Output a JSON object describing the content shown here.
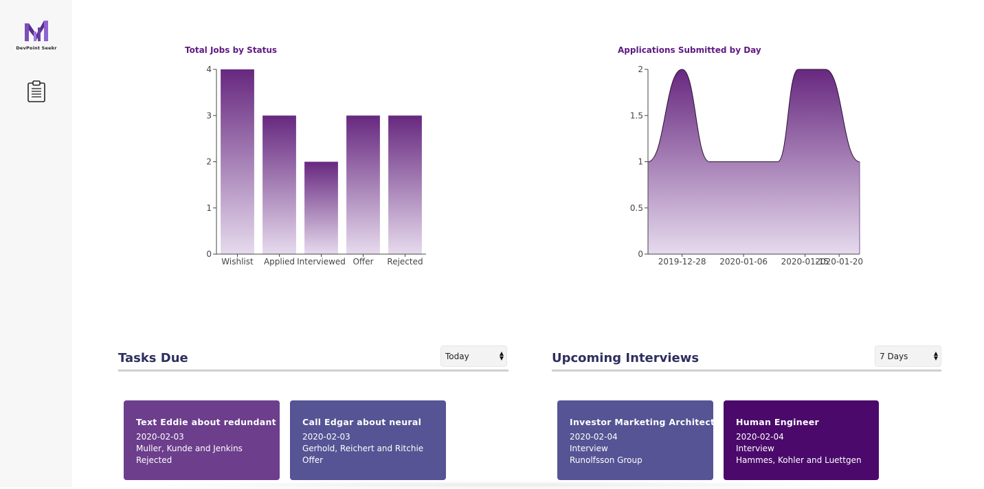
{
  "app": {
    "logo_text": "DevPoint Seekr"
  },
  "sidebar": {
    "items": [
      {
        "icon": "clipboard-icon"
      }
    ]
  },
  "colors": {
    "purple_dark": "#67287f",
    "purple_light": "#e6daed",
    "title": "#5e1a82",
    "card_violet": "#6c3e8c",
    "card_indigo": "#565494",
    "card_deep": "#4b0a6b"
  },
  "chart_data": [
    {
      "type": "bar",
      "title": "Total Jobs by Status",
      "categories": [
        "Wishlist",
        "Applied",
        "Interviewed",
        "Offer",
        "Rejected"
      ],
      "values": [
        4,
        3,
        2,
        3,
        3
      ],
      "ylim": [
        0,
        4
      ],
      "yticks": [
        0,
        1,
        2,
        3,
        4
      ],
      "grid": false
    },
    {
      "type": "area",
      "title": "Applications Submitted by Day",
      "x": [
        "2019-12-23",
        "2019-12-28",
        "2020-01-01",
        "2020-01-11",
        "2020-01-14",
        "2020-01-18",
        "2020-01-23"
      ],
      "values": [
        1,
        2,
        1,
        1,
        2,
        2,
        1
      ],
      "xticks": [
        "2019-12-28",
        "2020-01-06",
        "2020-01-15",
        "2020-01-20"
      ],
      "ylim": [
        0,
        2
      ],
      "yticks": [
        "0",
        "0.5",
        "1",
        "1.5",
        "2"
      ],
      "grid": false
    }
  ],
  "tasks": {
    "title": "Tasks Due",
    "filter": "Today",
    "cards": [
      {
        "title": "Text Eddie about redundant",
        "date": "2020-02-03",
        "company": "Muller, Kunde and Jenkins",
        "status": "Rejected"
      },
      {
        "title": "Call Edgar about neural",
        "date": "2020-02-03",
        "company": "Gerhold, Reichert and Ritchie",
        "status": "Offer"
      }
    ]
  },
  "interviews": {
    "title": "Upcoming Interviews",
    "filter": "7 Days",
    "cards": [
      {
        "title": "Investor Marketing Architect",
        "date": "2020-02-04",
        "type": "Interview",
        "company": "Runolfsson Group"
      },
      {
        "title": "Human Engineer",
        "date": "2020-02-04",
        "type": "Interview",
        "company": "Hammes, Kohler and Luettgen"
      }
    ]
  }
}
